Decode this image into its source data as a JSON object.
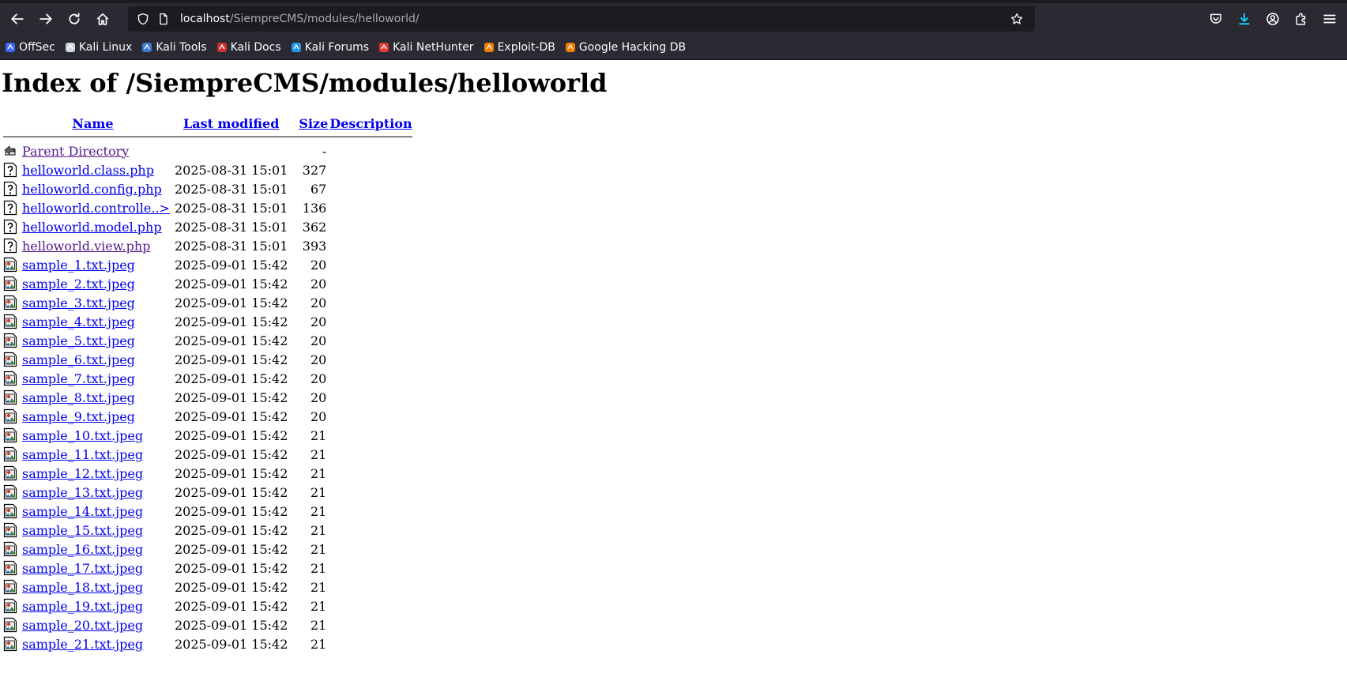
{
  "browser": {
    "url_host": "localhost",
    "url_path": "/SiempreCMS/modules/helloworld/",
    "bookmarks": [
      {
        "label": "OffSec",
        "icon": "offsec-icon",
        "color": "#3f6bff"
      },
      {
        "label": "Kali Linux",
        "icon": "kali-dragon-icon",
        "color": "#cfd8dc"
      },
      {
        "label": "Kali Tools",
        "icon": "kali-tools-icon",
        "color": "#3a7bd5"
      },
      {
        "label": "Kali Docs",
        "icon": "kali-docs-icon",
        "color": "#d32f2f"
      },
      {
        "label": "Kali Forums",
        "icon": "kali-forums-icon",
        "color": "#2196f3"
      },
      {
        "label": "Kali NetHunter",
        "icon": "nethunter-icon",
        "color": "#e53935"
      },
      {
        "label": "Exploit-DB",
        "icon": "exploitdb-icon",
        "color": "#f57c00"
      },
      {
        "label": "Google Hacking DB",
        "icon": "ghdb-icon",
        "color": "#f57c00"
      }
    ]
  },
  "page": {
    "title": "Index of /SiempreCMS/modules/helloworld",
    "columns": {
      "name": "Name",
      "modified": "Last modified",
      "size": "Size",
      "description": "Description"
    },
    "rows": [
      {
        "name": "Parent Directory",
        "modified": "",
        "size": "-",
        "type": "parent",
        "visited": true
      },
      {
        "name": "helloworld.class.php",
        "modified": "2025-08-31 15:01",
        "size": "327",
        "type": "unknown",
        "visited": false
      },
      {
        "name": "helloworld.config.php",
        "modified": "2025-08-31 15:01",
        "size": "67",
        "type": "unknown",
        "visited": false
      },
      {
        "name": "helloworld.controlle..>",
        "modified": "2025-08-31 15:01",
        "size": "136",
        "type": "unknown",
        "visited": false
      },
      {
        "name": "helloworld.model.php",
        "modified": "2025-08-31 15:01",
        "size": "362",
        "type": "unknown",
        "visited": false
      },
      {
        "name": "helloworld.view.php",
        "modified": "2025-08-31 15:01",
        "size": "393",
        "type": "unknown",
        "visited": true
      },
      {
        "name": "sample_1.txt.jpeg",
        "modified": "2025-09-01 15:42",
        "size": "20",
        "type": "image",
        "visited": false
      },
      {
        "name": "sample_2.txt.jpeg",
        "modified": "2025-09-01 15:42",
        "size": "20",
        "type": "image",
        "visited": false
      },
      {
        "name": "sample_3.txt.jpeg",
        "modified": "2025-09-01 15:42",
        "size": "20",
        "type": "image",
        "visited": false
      },
      {
        "name": "sample_4.txt.jpeg",
        "modified": "2025-09-01 15:42",
        "size": "20",
        "type": "image",
        "visited": false
      },
      {
        "name": "sample_5.txt.jpeg",
        "modified": "2025-09-01 15:42",
        "size": "20",
        "type": "image",
        "visited": false
      },
      {
        "name": "sample_6.txt.jpeg",
        "modified": "2025-09-01 15:42",
        "size": "20",
        "type": "image",
        "visited": false
      },
      {
        "name": "sample_7.txt.jpeg",
        "modified": "2025-09-01 15:42",
        "size": "20",
        "type": "image",
        "visited": false
      },
      {
        "name": "sample_8.txt.jpeg",
        "modified": "2025-09-01 15:42",
        "size": "20",
        "type": "image",
        "visited": false
      },
      {
        "name": "sample_9.txt.jpeg",
        "modified": "2025-09-01 15:42",
        "size": "20",
        "type": "image",
        "visited": false
      },
      {
        "name": "sample_10.txt.jpeg",
        "modified": "2025-09-01 15:42",
        "size": "21",
        "type": "image",
        "visited": false
      },
      {
        "name": "sample_11.txt.jpeg",
        "modified": "2025-09-01 15:42",
        "size": "21",
        "type": "image",
        "visited": false
      },
      {
        "name": "sample_12.txt.jpeg",
        "modified": "2025-09-01 15:42",
        "size": "21",
        "type": "image",
        "visited": false
      },
      {
        "name": "sample_13.txt.jpeg",
        "modified": "2025-09-01 15:42",
        "size": "21",
        "type": "image",
        "visited": false
      },
      {
        "name": "sample_14.txt.jpeg",
        "modified": "2025-09-01 15:42",
        "size": "21",
        "type": "image",
        "visited": false
      },
      {
        "name": "sample_15.txt.jpeg",
        "modified": "2025-09-01 15:42",
        "size": "21",
        "type": "image",
        "visited": false
      },
      {
        "name": "sample_16.txt.jpeg",
        "modified": "2025-09-01 15:42",
        "size": "21",
        "type": "image",
        "visited": false
      },
      {
        "name": "sample_17.txt.jpeg",
        "modified": "2025-09-01 15:42",
        "size": "21",
        "type": "image",
        "visited": false
      },
      {
        "name": "sample_18.txt.jpeg",
        "modified": "2025-09-01 15:42",
        "size": "21",
        "type": "image",
        "visited": false
      },
      {
        "name": "sample_19.txt.jpeg",
        "modified": "2025-09-01 15:42",
        "size": "21",
        "type": "image",
        "visited": false
      },
      {
        "name": "sample_20.txt.jpeg",
        "modified": "2025-09-01 15:42",
        "size": "21",
        "type": "image",
        "visited": false
      },
      {
        "name": "sample_21.txt.jpeg",
        "modified": "2025-09-01 15:42",
        "size": "21",
        "type": "image",
        "visited": false
      }
    ]
  }
}
